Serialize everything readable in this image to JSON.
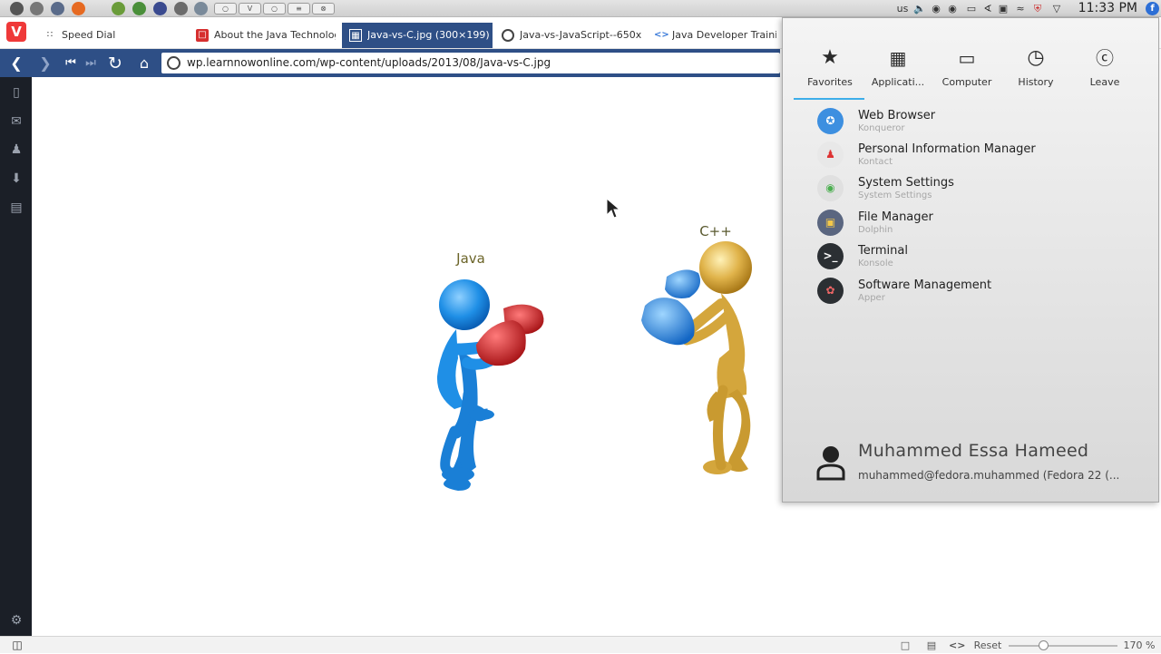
{
  "system_panel": {
    "launchers": [
      {
        "icon": "app-launcher-icon",
        "color": "#555555"
      },
      {
        "icon": "disk-icon",
        "color": "#777777"
      },
      {
        "icon": "camera-icon",
        "color": "#5a6b8a"
      },
      {
        "icon": "firefox-icon",
        "color": "#e66a22"
      },
      {
        "icon": "inkscape-icon",
        "color": "#6a9c3a"
      },
      {
        "icon": "ktorrent-icon",
        "color": "#4a8f3a"
      },
      {
        "icon": "flag-icon",
        "color": "#3a4a8f"
      },
      {
        "icon": "editor-icon",
        "color": "#6b6b6b"
      },
      {
        "icon": "bird-icon",
        "color": "#7a8a9a"
      },
      {
        "icon": "shield-icon",
        "color": "#3a5a9a"
      }
    ],
    "task_buttons": [
      "○",
      "V",
      "○",
      "≡",
      "⊗"
    ],
    "keyboard_layout": "us",
    "clock": "11:33 PM"
  },
  "browser": {
    "logo": "V",
    "tabs": [
      {
        "label": "Speed Dial",
        "icon": "grid-icon",
        "active": false
      },
      {
        "label": "About the Java Technolog",
        "icon": "java-icon",
        "active": false
      },
      {
        "label": "Java-vs-C.jpg (300×199)",
        "icon": "image-icon",
        "active": true
      },
      {
        "label": "Java-vs-JavaScript--650x",
        "icon": "globe-icon",
        "active": false
      },
      {
        "label": "Java Developer Trainin",
        "icon": "dev-icon",
        "active": false
      }
    ],
    "url": "wp.learnnowonline.com/wp-content/uploads/2013/08/Java-vs-C.jpg",
    "status_bar": {
      "reset_label": "Reset",
      "zoom_level": "170 %",
      "zoom_fraction": 0.32
    }
  },
  "image": {
    "left_label": "Java",
    "right_label": "C++"
  },
  "kickoff": {
    "tabs": [
      {
        "label": "Favorites",
        "icon": "star-icon"
      },
      {
        "label": "Applicati...",
        "icon": "applications-icon"
      },
      {
        "label": "Computer",
        "icon": "computer-icon"
      },
      {
        "label": "History",
        "icon": "history-icon"
      },
      {
        "label": "Leave",
        "icon": "leave-icon"
      }
    ],
    "favorites": [
      {
        "name": "Web Browser",
        "sub": "Konqueror",
        "icon": "konqueror-icon",
        "color": "#3d8fe0"
      },
      {
        "name": "Personal Information Manager",
        "sub": "Kontact",
        "icon": "kontact-icon",
        "color": "#e8e8e8"
      },
      {
        "name": "System Settings",
        "sub": "System Settings",
        "icon": "settings-icon",
        "color": "#e0e0e0"
      },
      {
        "name": "File Manager",
        "sub": "Dolphin",
        "icon": "folder-icon",
        "color": "#5a6680"
      },
      {
        "name": "Terminal",
        "sub": "Konsole",
        "icon": "terminal-icon",
        "color": "#2b2f33"
      },
      {
        "name": "Software Management",
        "sub": "Apper",
        "icon": "apper-icon",
        "color": "#2b2f33"
      }
    ],
    "user": {
      "name": "Muhammed Essa Hameed",
      "host": "muhammed@fedora.muhammed (Fedora 22 (..."
    }
  }
}
